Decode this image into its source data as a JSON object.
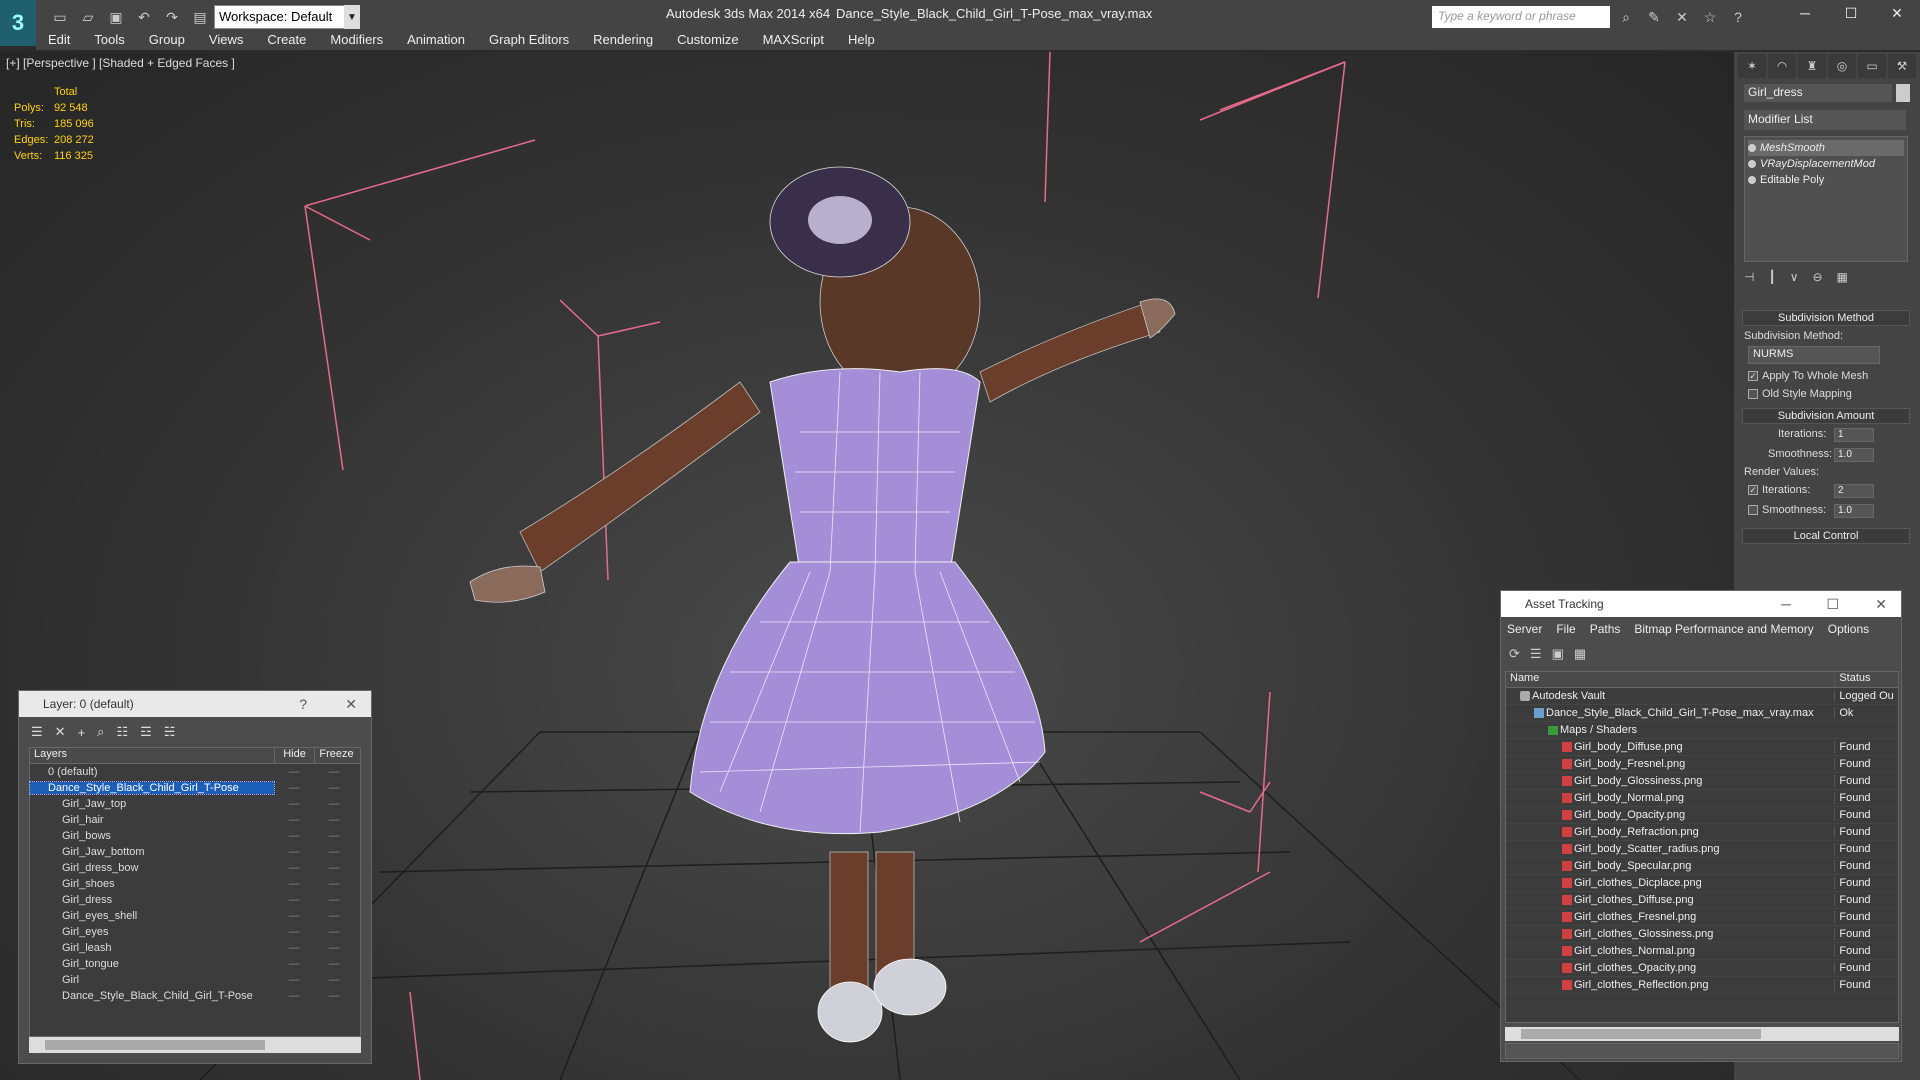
{
  "titlebar": {
    "workspace": "Workspace: Default",
    "app_title": "Autodesk 3ds Max  2014 x64",
    "doc_title": "Dance_Style_Black_Child_Girl_T-Pose_max_vray.max",
    "search_placeholder": "Type a keyword or phrase"
  },
  "menu": [
    "Edit",
    "Tools",
    "Group",
    "Views",
    "Create",
    "Modifiers",
    "Animation",
    "Graph Editors",
    "Rendering",
    "Customize",
    "MAXScript",
    "Help"
  ],
  "viewport": {
    "label": "[+] [Perspective ] [Shaded + Edged Faces ]",
    "stats": {
      "total_label": "Total",
      "rows": [
        {
          "k": "Polys:",
          "v": "92 548"
        },
        {
          "k": "Tris:",
          "v": "185 096"
        },
        {
          "k": "Edges:",
          "v": "208 272"
        },
        {
          "k": "Verts:",
          "v": "116 325"
        }
      ]
    }
  },
  "command_panel": {
    "object_name": "Girl_dress",
    "modifier_list": "Modifier List",
    "stack": [
      "MeshSmooth",
      "VRayDisplacementMod",
      "Editable Poly"
    ],
    "subdivision_method_title": "Subdivision Method",
    "subdivision_method_label": "Subdivision Method:",
    "subdivision_method_value": "NURMS",
    "apply_whole_mesh": "Apply To Whole Mesh",
    "old_style_mapping": "Old Style Mapping",
    "subdivision_amount_title": "Subdivision Amount",
    "iterations_label": "Iterations:",
    "iterations_value": "1",
    "smoothness_label": "Smoothness:",
    "smoothness_value": "1.0",
    "render_values_label": "Render Values:",
    "render_iterations_label": "Iterations:",
    "render_iterations_value": "2",
    "render_smoothness_label": "Smoothness:",
    "render_smoothness_value": "1.0",
    "local_control_title": "Local Control"
  },
  "layer_window": {
    "title": "Layer: 0 (default)",
    "help": "?",
    "col_layers": "Layers",
    "col_hide": "Hide",
    "col_freeze": "Freeze",
    "rows": [
      {
        "name": "0 (default)",
        "indent": 1
      },
      {
        "name": "Dance_Style_Black_Child_Girl_T-Pose",
        "indent": 1
      },
      {
        "name": "Girl_Jaw_top",
        "indent": 2
      },
      {
        "name": "Girl_hair",
        "indent": 2
      },
      {
        "name": "Girl_bows",
        "indent": 2
      },
      {
        "name": "Girl_Jaw_bottom",
        "indent": 2
      },
      {
        "name": "Girl_dress_bow",
        "indent": 2
      },
      {
        "name": "Girl_shoes",
        "indent": 2
      },
      {
        "name": "Girl_dress",
        "indent": 2
      },
      {
        "name": "Girl_eyes_shell",
        "indent": 2
      },
      {
        "name": "Girl_eyes",
        "indent": 2
      },
      {
        "name": "Girl_leash",
        "indent": 2
      },
      {
        "name": "Girl_tongue",
        "indent": 2
      },
      {
        "name": "Girl",
        "indent": 2
      },
      {
        "name": "Dance_Style_Black_Child_Girl_T-Pose",
        "indent": 2
      }
    ]
  },
  "asset_window": {
    "title": "Asset Tracking",
    "menu": [
      "Server",
      "File",
      "Paths",
      "Bitmap Performance and Memory",
      "Options"
    ],
    "col_name": "Name",
    "col_status": "Status",
    "rows": [
      {
        "name": "Autodesk Vault",
        "status": "Logged Ou",
        "kind": "vault",
        "indent": 1
      },
      {
        "name": "Dance_Style_Black_Child_Girl_T-Pose_max_vray.max",
        "status": "Ok",
        "kind": "file",
        "indent": 2
      },
      {
        "name": "Maps / Shaders",
        "status": "",
        "kind": "folder",
        "indent": 3
      },
      {
        "name": "Girl_body_Diffuse.png",
        "status": "Found",
        "kind": "png",
        "indent": 4
      },
      {
        "name": "Girl_body_Fresnel.png",
        "status": "Found",
        "kind": "png",
        "indent": 4
      },
      {
        "name": "Girl_body_Glossiness.png",
        "status": "Found",
        "kind": "png",
        "indent": 4
      },
      {
        "name": "Girl_body_Normal.png",
        "status": "Found",
        "kind": "png",
        "indent": 4
      },
      {
        "name": "Girl_body_Opacity.png",
        "status": "Found",
        "kind": "png",
        "indent": 4
      },
      {
        "name": "Girl_body_Refraction.png",
        "status": "Found",
        "kind": "png",
        "indent": 4
      },
      {
        "name": "Girl_body_Scatter_radius.png",
        "status": "Found",
        "kind": "png",
        "indent": 4
      },
      {
        "name": "Girl_body_Specular.png",
        "status": "Found",
        "kind": "png",
        "indent": 4
      },
      {
        "name": "Girl_clothes_Dicplace.png",
        "status": "Found",
        "kind": "png",
        "indent": 4
      },
      {
        "name": "Girl_clothes_Diffuse.png",
        "status": "Found",
        "kind": "png",
        "indent": 4
      },
      {
        "name": "Girl_clothes_Fresnel.png",
        "status": "Found",
        "kind": "png",
        "indent": 4
      },
      {
        "name": "Girl_clothes_Glossiness.png",
        "status": "Found",
        "kind": "png",
        "indent": 4
      },
      {
        "name": "Girl_clothes_Normal.png",
        "status": "Found",
        "kind": "png",
        "indent": 4
      },
      {
        "name": "Girl_clothes_Opacity.png",
        "status": "Found",
        "kind": "png",
        "indent": 4
      },
      {
        "name": "Girl_clothes_Reflection.png",
        "status": "Found",
        "kind": "png",
        "indent": 4
      }
    ]
  },
  "colors": {
    "stats": "#ffd200",
    "selection": "#1b5fba",
    "bbox": "#e86a8a",
    "dress": "#a58ed8",
    "skin": "#6a3e2a"
  }
}
